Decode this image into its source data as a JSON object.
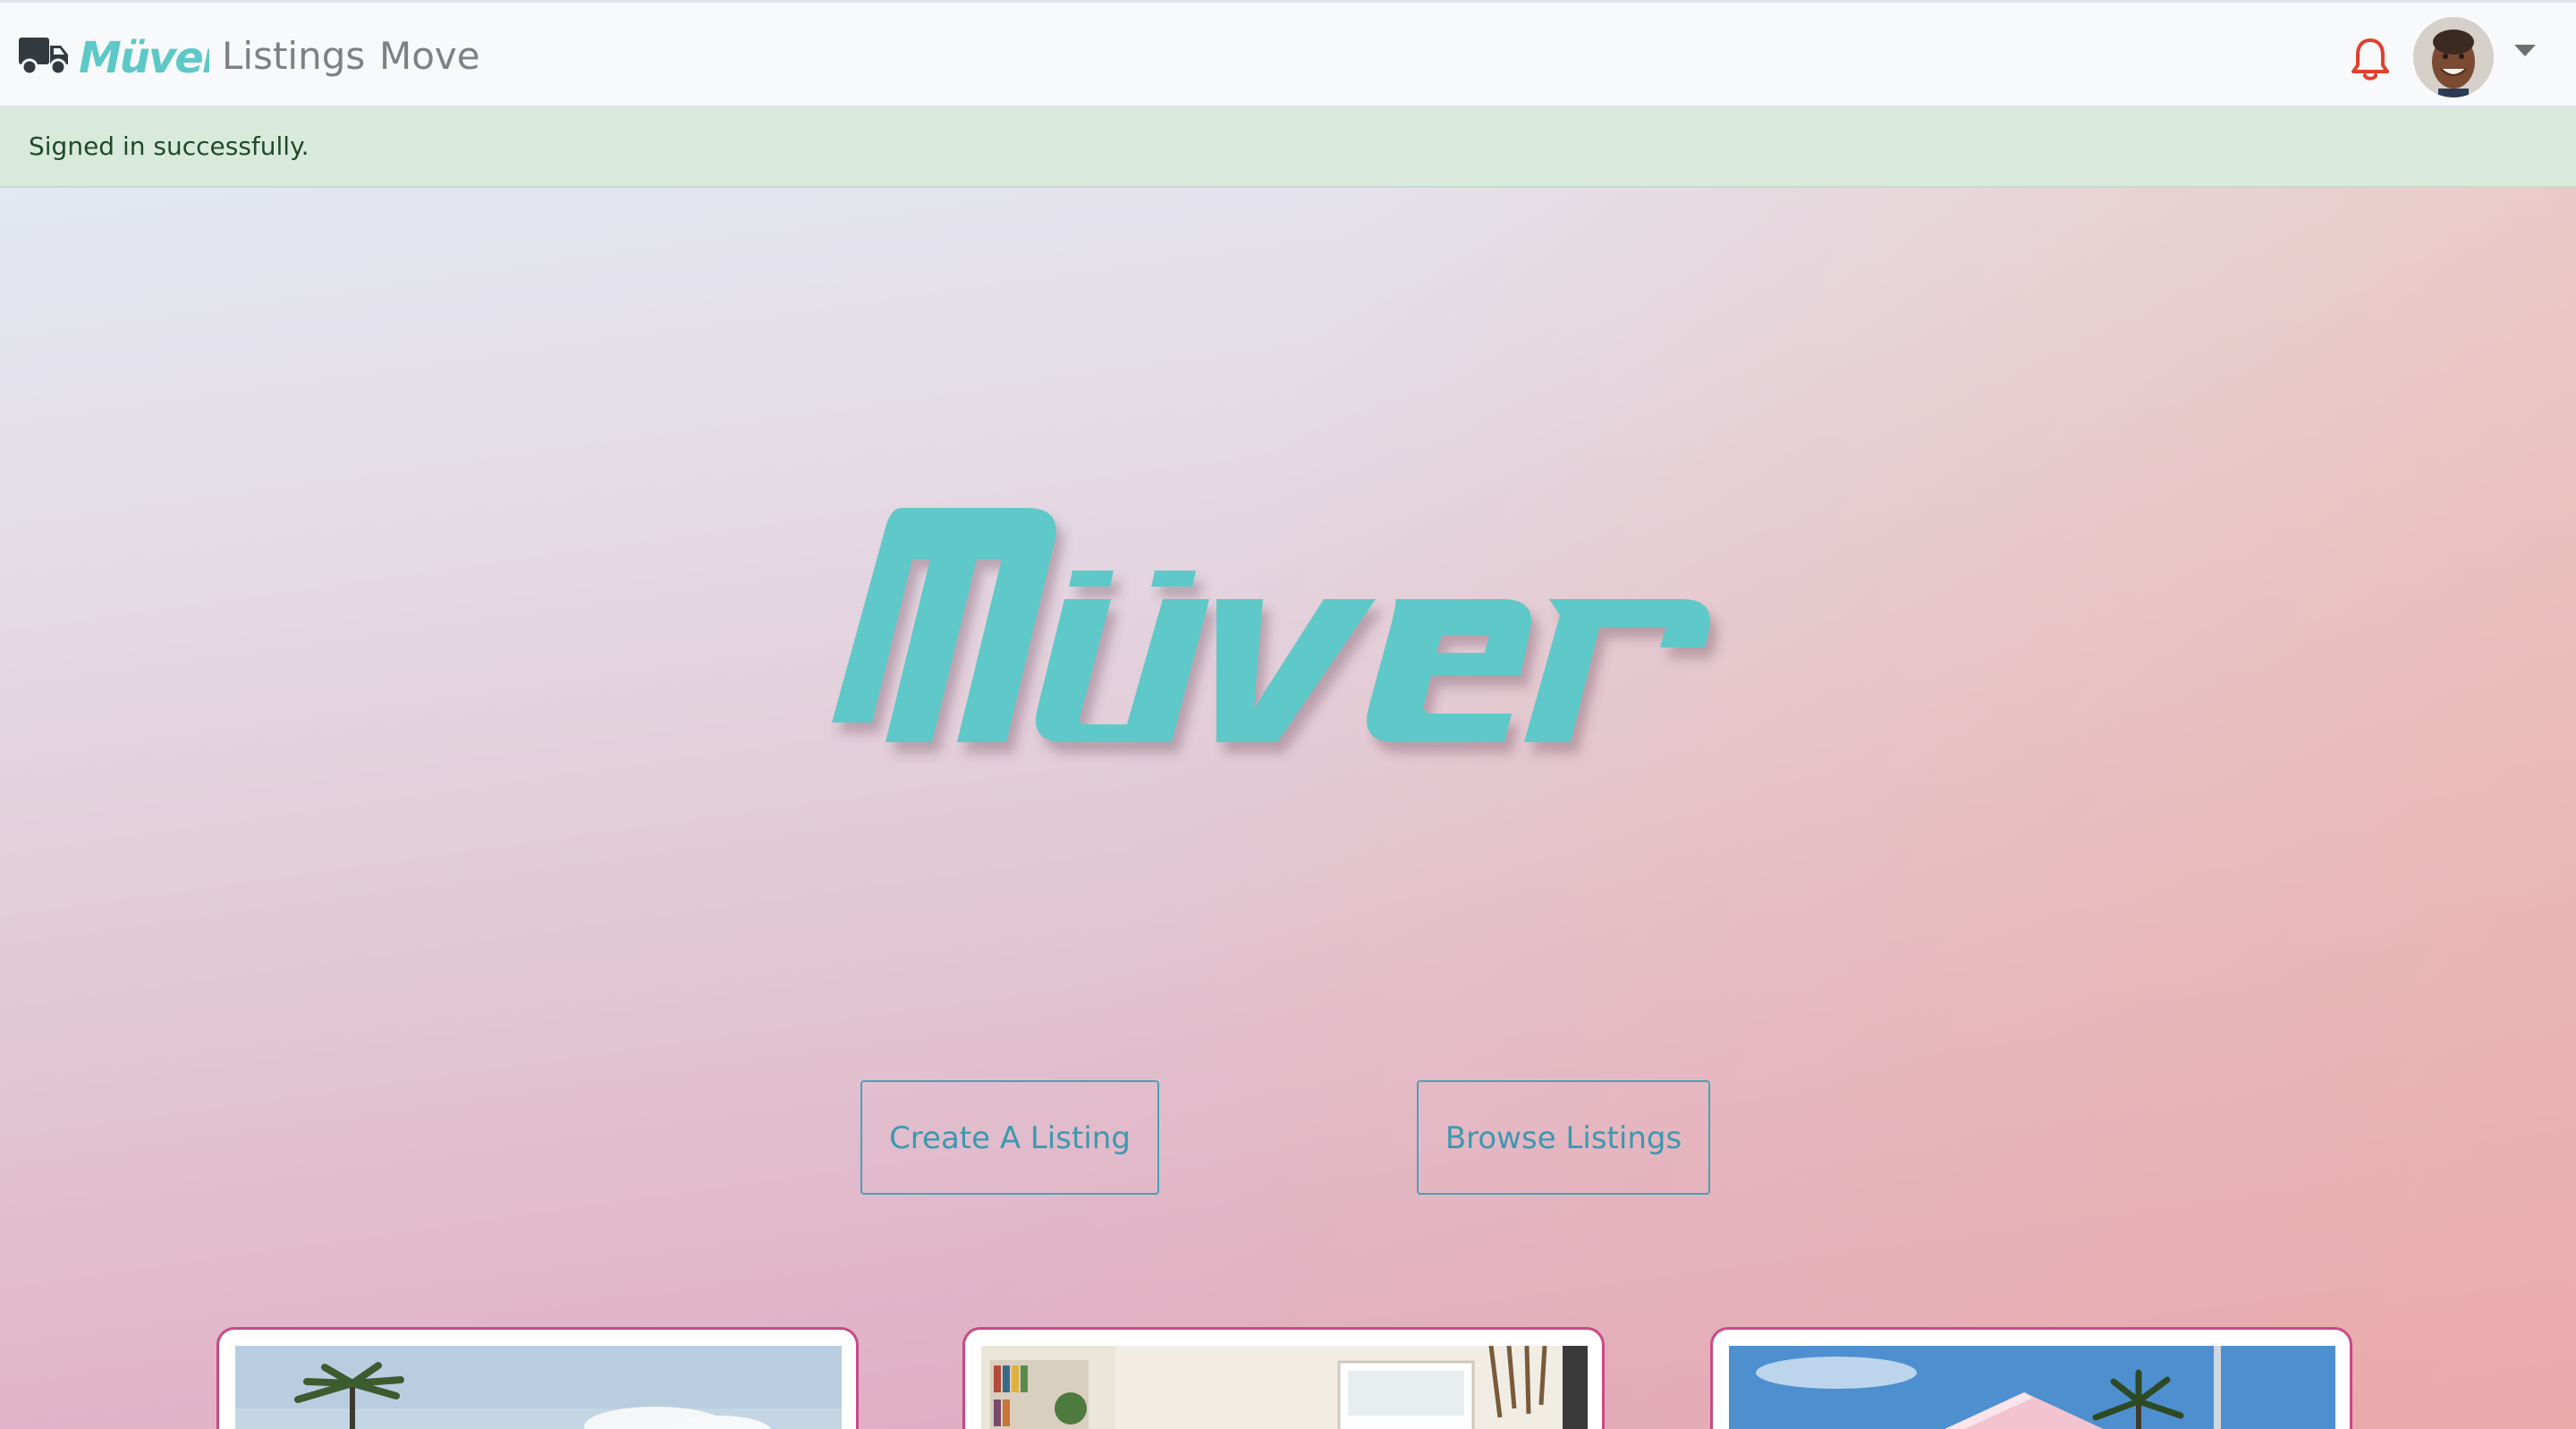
{
  "navbar": {
    "brand_logo_icon": "muver-wordmark",
    "truck_icon": "truck-icon",
    "links": [
      {
        "label": "Listings"
      },
      {
        "label": "Move"
      }
    ],
    "bell_icon": "bell-icon",
    "avatar_icon": "user-avatar",
    "dropdown_icon": "caret-down-icon",
    "colors": {
      "bell": "#e0402e",
      "brand": "#5ec8c8"
    }
  },
  "alert": {
    "message": "Signed in successfully."
  },
  "hero": {
    "logo_icon": "muver-hero-logo",
    "buttons": {
      "create": "Create A Listing",
      "browse": "Browse Listings"
    },
    "colors": {
      "button_accent": "#3d98b0",
      "card_border": "#c94a86"
    }
  },
  "cards": [
    {
      "image": "palm-tree-sky-photo"
    },
    {
      "image": "interior-room-photo"
    },
    {
      "image": "pink-house-palm-photo"
    }
  ]
}
